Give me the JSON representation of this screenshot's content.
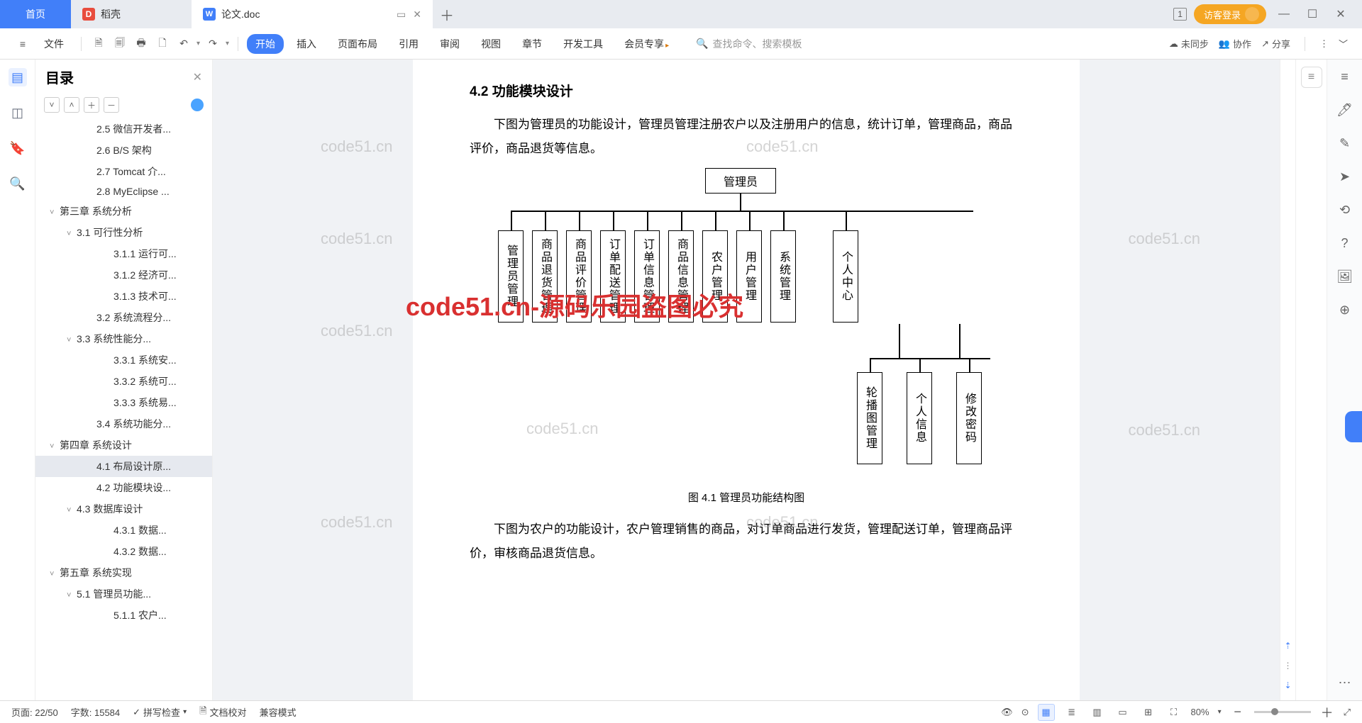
{
  "tabs": {
    "home": "首页",
    "app": "稻壳",
    "doc": "论文.doc"
  },
  "login": "访客登录",
  "badge1": "1",
  "menu": {
    "file": "文件",
    "start": "开始",
    "insert": "插入",
    "layout": "页面布局",
    "ref": "引用",
    "review": "审阅",
    "view": "视图",
    "chapter": "章节",
    "devtools": "开发工具",
    "vip": "会员专享"
  },
  "search": {
    "placeholder": "查找命令、搜索模板"
  },
  "toolbarRight": {
    "sync": "未同步",
    "collab": "协作",
    "share": "分享"
  },
  "outline": {
    "title": "目录",
    "items": [
      {
        "lvl": 3,
        "t": "2.5 微信开发者..."
      },
      {
        "lvl": 3,
        "t": "2.6 B/S 架构"
      },
      {
        "lvl": 3,
        "t": "2.7 Tomcat 介..."
      },
      {
        "lvl": 3,
        "t": "2.8 MyEclipse ..."
      },
      {
        "lvl": 1,
        "t": "第三章  系统分析",
        "c": true
      },
      {
        "lvl": 2,
        "t": "3.1 可行性分析",
        "c": true
      },
      {
        "lvl": 4,
        "t": "3.1.1 运行可..."
      },
      {
        "lvl": 4,
        "t": "3.1.2 经济可..."
      },
      {
        "lvl": 4,
        "t": "3.1.3 技术可..."
      },
      {
        "lvl": 3,
        "t": "3.2 系统流程分..."
      },
      {
        "lvl": 2,
        "t": "3.3 系统性能分...",
        "c": true
      },
      {
        "lvl": 4,
        "t": "3.3.1 系统安..."
      },
      {
        "lvl": 4,
        "t": "3.3.2 系统可..."
      },
      {
        "lvl": 4,
        "t": "3.3.3 系统易..."
      },
      {
        "lvl": 3,
        "t": "3.4 系统功能分..."
      },
      {
        "lvl": 1,
        "t": "第四章  系统设计",
        "c": true
      },
      {
        "lvl": 3,
        "t": "4.1 布局设计原...",
        "active": true
      },
      {
        "lvl": 3,
        "t": "4.2 功能模块设..."
      },
      {
        "lvl": 2,
        "t": "4.3 数据库设计",
        "c": true
      },
      {
        "lvl": 4,
        "t": "4.3.1 数据..."
      },
      {
        "lvl": 4,
        "t": "4.3.2 数据..."
      },
      {
        "lvl": 1,
        "t": "第五章  系统实现",
        "c": true
      },
      {
        "lvl": 2,
        "t": "5.1 管理员功能...",
        "c": true
      },
      {
        "lvl": 4,
        "t": "5.1.1 农户..."
      }
    ]
  },
  "doc": {
    "h42": "4.2 功能模块设计",
    "p1": "下图为管理员的功能设计，管理员管理注册农户以及注册用户的信息，统计订单，管理商品，商品评价，商品退货等信息。",
    "caption": "图 4.1  管理员功能结构图",
    "p2": "下图为农户的功能设计，农户管理销售的商品，对订单商品进行发货，管理配送订单，管理商品评价，审核商品退货信息。"
  },
  "org": {
    "root": "管理员",
    "row1": [
      "管理员管理",
      "商品退货管理",
      "商品评价管理",
      "订单配送管理",
      "订单信息管理",
      "商品信息管理",
      "农户管理",
      "用户管理",
      "系统管理",
      "个人中心"
    ],
    "row2": [
      "轮播图管理",
      "个人信息",
      "修改密码"
    ]
  },
  "watermark": "code51.cn",
  "watermark_red": "code51.cn-源码乐园盗图必究",
  "status": {
    "page": "页面: 22/50",
    "words": "字数: 15584",
    "spell": "拼写检查",
    "proof": "文档校对",
    "compat": "兼容模式",
    "zoom": "80%"
  }
}
